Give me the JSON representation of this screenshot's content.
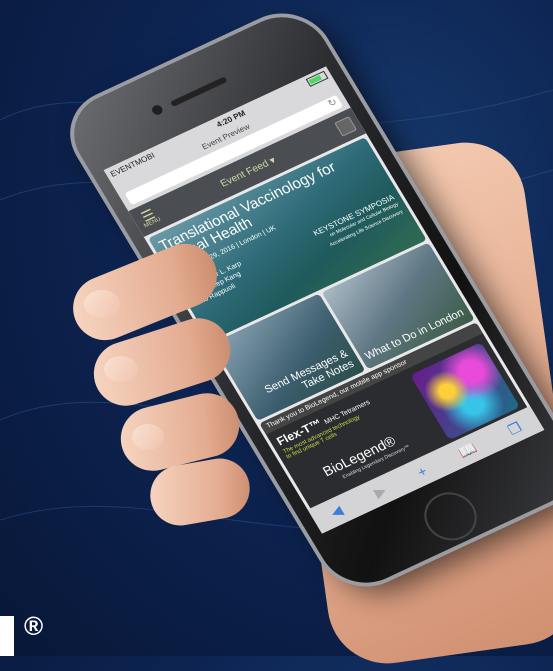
{
  "status": {
    "carrier": "EVENTMOBI",
    "time": "4:20 PM"
  },
  "browser": {
    "title": "Event Preview"
  },
  "appbar": {
    "menu_label": "MENU",
    "feed_label": "Event Feed ▾"
  },
  "hero": {
    "title": "Translational Vaccinology for Global Health",
    "date": "October 25-29, 2016 | London | UK",
    "organizers_label": "Organizers:",
    "organizers": [
      "Christopher L. Karp",
      "Gagandeep Kang",
      "Rino Rappuoli"
    ],
    "brand": "KEYSTONE SYMPOSIA",
    "brand_sub": "on Molecular and Cellular Biology",
    "brand_tag": "Accelerating Life Science Discovery"
  },
  "tiles": [
    {
      "label": "Send Messages & Take Notes"
    },
    {
      "label": "What to Do in London"
    }
  ],
  "sponsor": {
    "thanks": "Thank you to BioLegend, our mobile app sponsor",
    "product": "Flex-T™",
    "product_sub": "MHC Tetramers",
    "desc": "The most advanced technology to find unique T cells",
    "logo": "BioLegend®",
    "tagline": "Enabling Legendary Discovery™"
  },
  "registered_mark": "®"
}
